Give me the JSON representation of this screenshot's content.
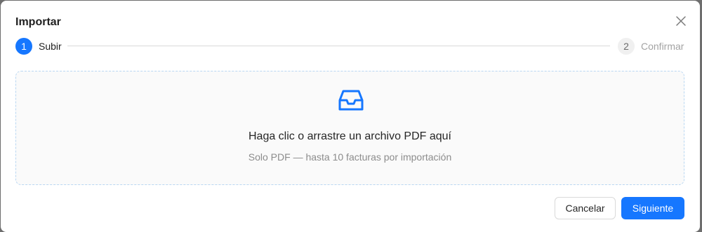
{
  "modal": {
    "title": "Importar",
    "close_icon": "close-icon"
  },
  "steps": [
    {
      "number": "1",
      "label": "Subir",
      "status": "active"
    },
    {
      "number": "2",
      "label": "Confirmar",
      "status": "wait"
    }
  ],
  "upload": {
    "icon": "inbox-icon",
    "main_text": "Haga clic o arrastre un archivo PDF aquí",
    "hint_text": "Solo PDF — hasta 10 facturas por importación"
  },
  "footer": {
    "cancel_label": "Cancelar",
    "next_label": "Siguiente"
  },
  "colors": {
    "primary": "#1677ff",
    "step_wait_bg": "#f0f0f0",
    "dropzone_border": "#b9d7f2"
  }
}
